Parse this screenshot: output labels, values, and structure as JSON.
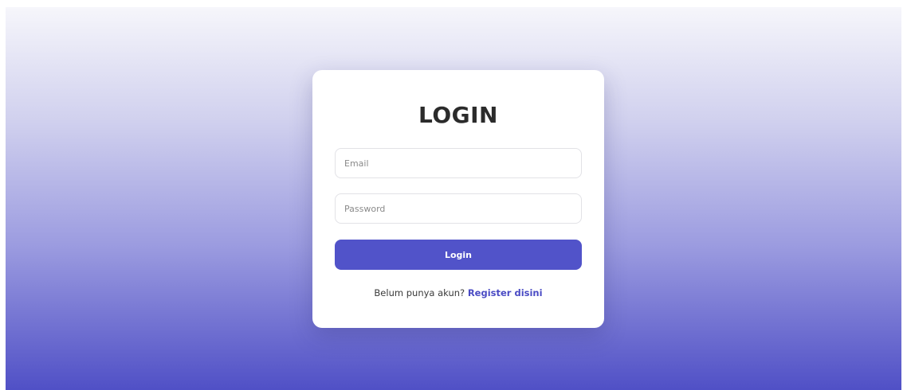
{
  "login_form": {
    "title": "LOGIN",
    "email_placeholder": "Email",
    "password_placeholder": "Password",
    "submit_label": "Login",
    "register_prompt": "Belum punya akun?",
    "register_link": "Register disini"
  },
  "colors": {
    "accent": "#5153c9",
    "link": "#4a4bc4",
    "background_top": "#f6f6fb",
    "background_bottom": "#5050c6"
  }
}
